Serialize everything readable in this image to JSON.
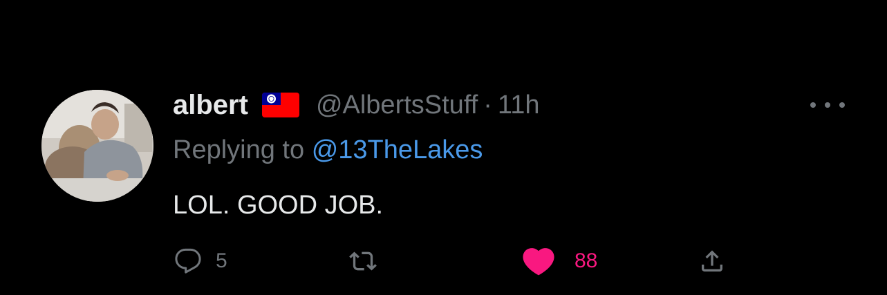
{
  "tweet": {
    "author_name": "albert",
    "flag_icon": "taiwan-flag-icon",
    "handle": "@AlbertsStuff",
    "separator": "·",
    "time": "11h",
    "replying_prefix": "Replying to",
    "replying_to": "@13TheLakes",
    "text": "LOL. GOOD JOB."
  },
  "actions": {
    "reply_count": "5",
    "retweet_count": "",
    "like_count": "88",
    "liked": true
  },
  "icons": {
    "reply": "reply-bubble-icon",
    "retweet": "retweet-icon",
    "like": "heart-icon",
    "share": "share-icon",
    "more": "more-dots-icon"
  },
  "colors": {
    "background": "#000000",
    "primary_text": "#e7e9ea",
    "secondary_text": "#71767b",
    "link": "#4a99e9",
    "like": "#f91880"
  }
}
